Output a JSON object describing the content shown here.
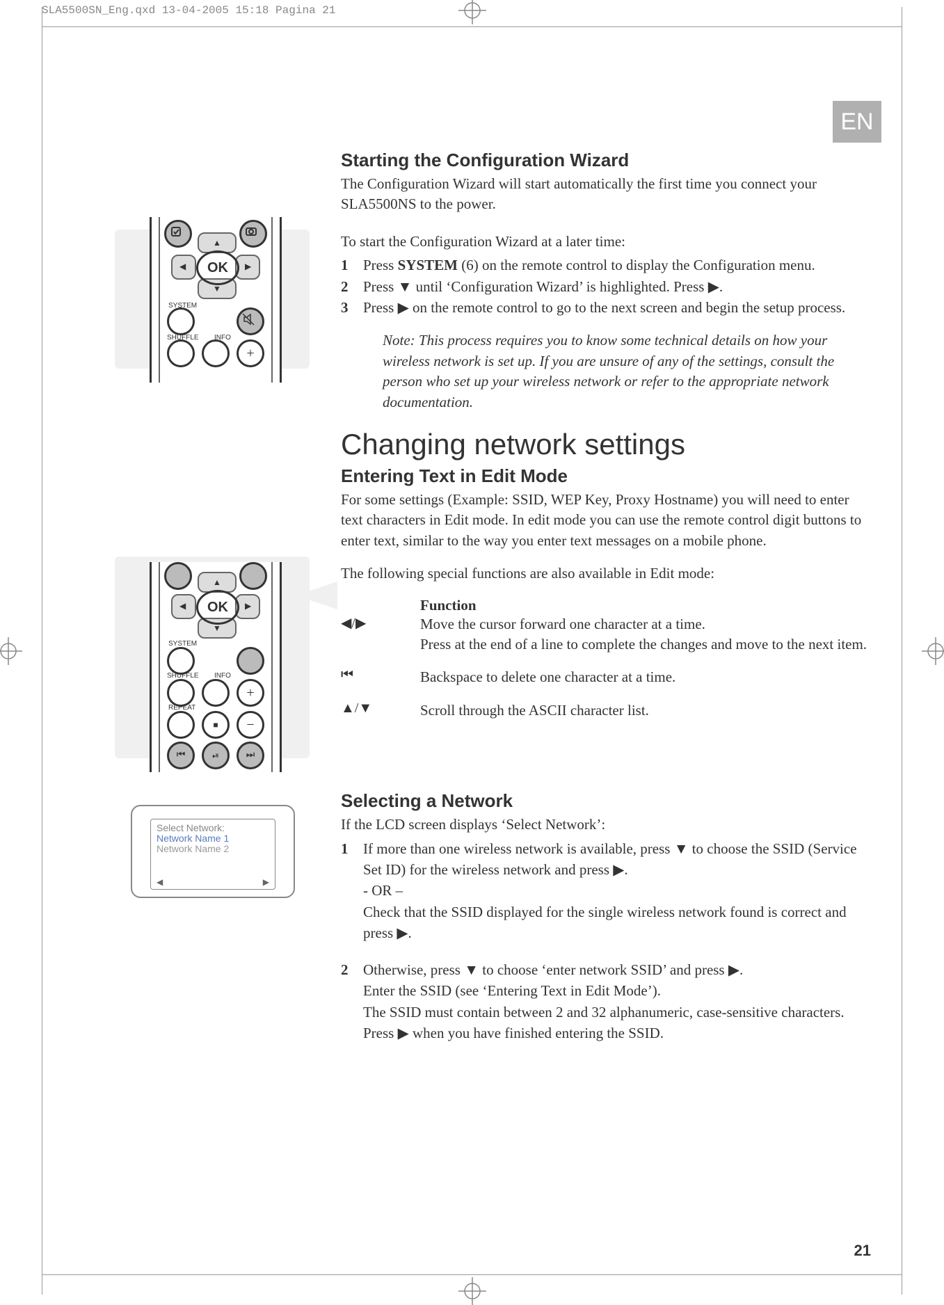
{
  "print_header": "SLA5500SN_Eng.qxd  13-04-2005  15:18  Pagina 21",
  "lang_tab": "EN",
  "page_number": "21",
  "section1": {
    "heading": "Starting the Configuration Wizard",
    "intro": "The Configuration Wizard will start automatically the first time you connect your SLA5500NS to the power.",
    "lead": "To start the Configuration Wizard at a later time:",
    "steps": [
      {
        "n": "1",
        "pre": "Press ",
        "bold": "SYSTEM",
        "post": " (6) on the remote control to display the Configuration menu."
      },
      {
        "n": "2",
        "text": "Press ▼ until ‘Configuration Wizard’ is highlighted. Press ▶."
      },
      {
        "n": "3",
        "text": "Press ▶ on the remote control to go to the next screen and begin the setup process."
      }
    ],
    "note": "Note: This process requires you to know some technical details on how your wireless network is set up. If you are unsure of any of the settings, consult the person who set up your wireless network or refer to the appropriate network documentation."
  },
  "section2": {
    "main_heading": "Changing network settings",
    "sub_heading": "Entering Text in Edit Mode",
    "intro": "For some settings (Example: SSID, WEP Key, Proxy Hostname) you will need to enter text characters in Edit mode. In edit mode you can use the remote control digit buttons to enter text, similar to the way you enter text messages on a mobile phone.",
    "lead": "The following special functions are also available in Edit mode:",
    "func_header": "Function",
    "functions": [
      {
        "sym": "◀/▶",
        "desc": "Move the cursor forward one character at a time.\nPress at the end of a line to complete the changes and move to the next item."
      },
      {
        "sym": "⏮",
        "desc": "Backspace to delete one character at a time."
      },
      {
        "sym": "▲/▼",
        "desc": "Scroll through the ASCII character list."
      }
    ]
  },
  "section3": {
    "heading": "Selecting a Network",
    "lead": "If the LCD screen displays ‘Select Network’:",
    "step1_a": "If more than one wireless network is available, press ▼ to choose the SSID (Service Set ID) for the wireless network and press ▶.",
    "step1_or": "- OR –",
    "step1_b": "Check that the SSID displayed for the single wireless network found is correct and press ▶.",
    "step2_a": "Otherwise, press ▼ to choose ‘enter network SSID’ and press ▶.",
    "step2_b": "Enter the SSID (see ‘Entering Text in Edit Mode’).",
    "step2_c": "The SSID must contain between 2 and 32 alphanumeric, case-sensitive characters.",
    "step2_d": "Press ▶ when you have finished entering the SSID."
  },
  "remote": {
    "ok": "OK",
    "system": "SYSTEM",
    "shuffle": "SHUFFLE",
    "info": "INFO",
    "repeat": "REPEAT"
  },
  "lcd": {
    "title": "Select Network:",
    "line1": "Network Name 1",
    "line2": "Network Name 2"
  }
}
